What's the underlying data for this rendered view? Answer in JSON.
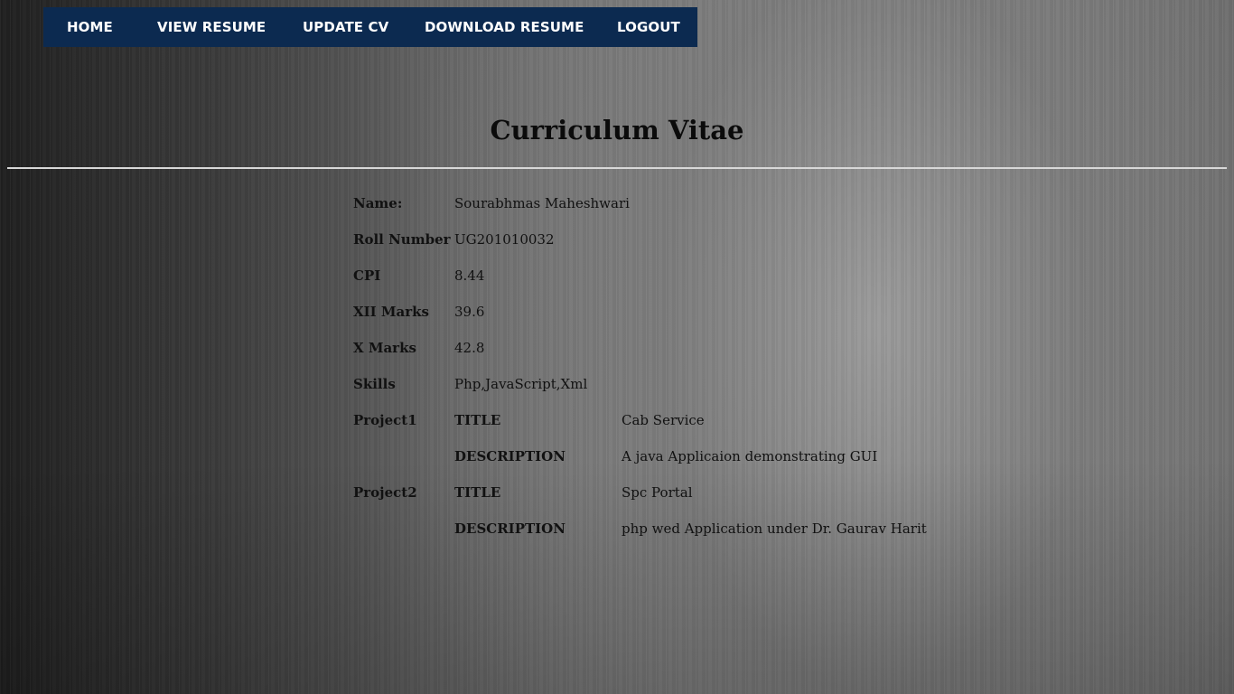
{
  "nav": {
    "home": "HOME",
    "view_resume": "VIEW RESUME",
    "update_cv": "UPDATE CV",
    "download_resume": "DOWNLOAD RESUME",
    "logout": "LOGOUT",
    "background_color": "#0c2a50"
  },
  "page": {
    "title": "Curriculum Vitae"
  },
  "cv": {
    "name_label": "Name:",
    "name_value": "Sourabhmas Maheshwari",
    "roll_label": "Roll Number",
    "roll_value": "UG201010032",
    "cpi_label": "CPI",
    "cpi_value": "8.44",
    "xii_label": "XII Marks",
    "xii_value": "39.6",
    "x_label": "X Marks",
    "x_value": "42.8",
    "skills_label": "Skills",
    "skills_value": "Php,JavaScript,Xml",
    "projects": [
      {
        "label": "Project1",
        "title_label": "TITLE",
        "title_value": "Cab Service",
        "description_label": "DESCRIPTION",
        "description_value": "A java Applicaion demonstrating GUI"
      },
      {
        "label": "Project2",
        "title_label": "TITLE",
        "title_value": "Spc Portal",
        "description_label": "DESCRIPTION",
        "description_value": "php wed Application under Dr. Gaurav Harit"
      }
    ]
  }
}
